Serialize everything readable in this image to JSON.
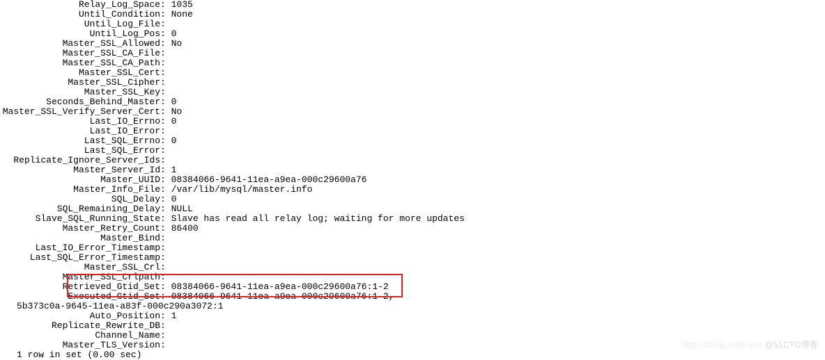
{
  "status": {
    "rows": [
      {
        "label": "Relay_Log_Space",
        "value": "1035"
      },
      {
        "label": "Until_Condition",
        "value": "None"
      },
      {
        "label": "Until_Log_File",
        "value": ""
      },
      {
        "label": "Until_Log_Pos",
        "value": "0"
      },
      {
        "label": "Master_SSL_Allowed",
        "value": "No"
      },
      {
        "label": "Master_SSL_CA_File",
        "value": ""
      },
      {
        "label": "Master_SSL_CA_Path",
        "value": ""
      },
      {
        "label": "Master_SSL_Cert",
        "value": ""
      },
      {
        "label": "Master_SSL_Cipher",
        "value": ""
      },
      {
        "label": "Master_SSL_Key",
        "value": ""
      },
      {
        "label": "Seconds_Behind_Master",
        "value": "0"
      },
      {
        "label": "Master_SSL_Verify_Server_Cert",
        "value": "No"
      },
      {
        "label": "Last_IO_Errno",
        "value": "0"
      },
      {
        "label": "Last_IO_Error",
        "value": ""
      },
      {
        "label": "Last_SQL_Errno",
        "value": "0"
      },
      {
        "label": "Last_SQL_Error",
        "value": ""
      },
      {
        "label": "Replicate_Ignore_Server_Ids",
        "value": ""
      },
      {
        "label": "Master_Server_Id",
        "value": "1"
      },
      {
        "label": "Master_UUID",
        "value": "08384066-9641-11ea-a9ea-000c29600a76"
      },
      {
        "label": "Master_Info_File",
        "value": "/var/lib/mysql/master.info"
      },
      {
        "label": "SQL_Delay",
        "value": "0"
      },
      {
        "label": "SQL_Remaining_Delay",
        "value": "NULL"
      },
      {
        "label": "Slave_SQL_Running_State",
        "value": "Slave has read all relay log; waiting for more updates"
      },
      {
        "label": "Master_Retry_Count",
        "value": "86400"
      },
      {
        "label": "Master_Bind",
        "value": ""
      },
      {
        "label": "Last_IO_Error_Timestamp",
        "value": ""
      },
      {
        "label": "Last_SQL_Error_Timestamp",
        "value": ""
      },
      {
        "label": "Master_SSL_Crl",
        "value": ""
      },
      {
        "label": "Master_SSL_Crlpath",
        "value": ""
      },
      {
        "label": "Retrieved_Gtid_Set",
        "value": "08384066-9641-11ea-a9ea-000c29600a76:1-2"
      },
      {
        "label": "Executed_Gtid_Set",
        "value": "08384066-9641-11ea-a9ea-000c29600a76:1-2,"
      },
      {
        "continuation": "5b373c0a-9645-11ea-a83f-000c290a3072:1"
      },
      {
        "label": "Auto_Position",
        "value": "1"
      },
      {
        "label": "Replicate_Rewrite_DB",
        "value": ""
      },
      {
        "label": "Channel_Name",
        "value": ""
      },
      {
        "label": "Master_TLS_Version",
        "value": ""
      }
    ]
  },
  "footer": "1 row in set (0.00 sec)",
  "watermark": {
    "faint": "https://blog.csdn.net/  ",
    "text": "@51CTO博客"
  }
}
